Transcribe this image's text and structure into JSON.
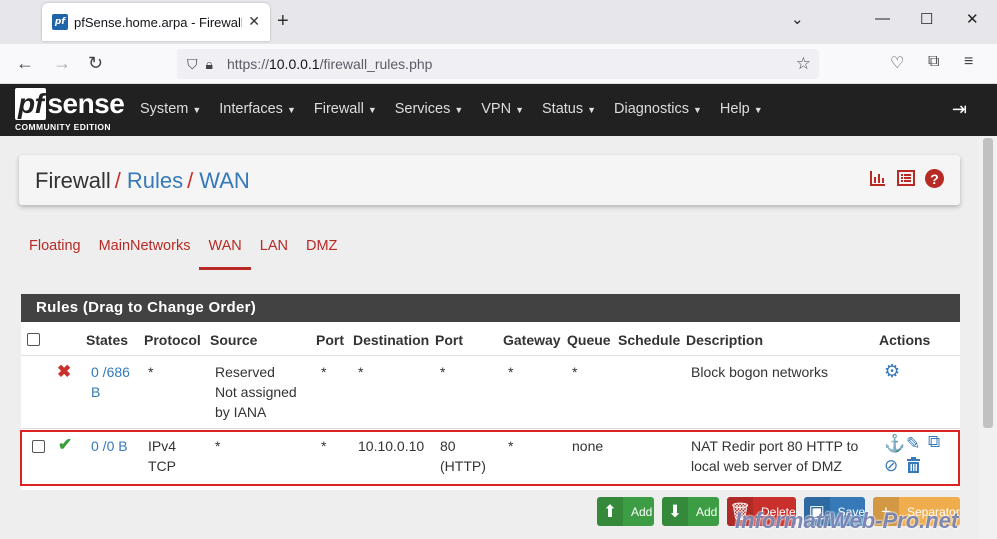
{
  "browser": {
    "tab_title": "pfSense.home.arpa - Firewall: R",
    "favicon_text": "pf",
    "url_prefix": "https://",
    "url_host": "10.0.0.1",
    "url_path": "/firewall_rules.php"
  },
  "header": {
    "logo_pf": "pf",
    "logo_sense": "sense",
    "logo_sub": "COMMUNITY EDITION",
    "menu": [
      "System",
      "Interfaces",
      "Firewall",
      "Services",
      "VPN",
      "Status",
      "Diagnostics",
      "Help"
    ]
  },
  "breadcrumb": {
    "home": "Firewall",
    "sep": "/",
    "rules": "Rules",
    "current": "WAN"
  },
  "tabs": [
    {
      "label": "Floating",
      "active": false
    },
    {
      "label": "MainNetworks",
      "active": false
    },
    {
      "label": "WAN",
      "active": true
    },
    {
      "label": "LAN",
      "active": false
    },
    {
      "label": "DMZ",
      "active": false
    }
  ],
  "rules_panel": {
    "title": "Rules (Drag to Change Order)",
    "columns": {
      "states": "States",
      "protocol": "Protocol",
      "source": "Source",
      "port": "Port",
      "destination": "Destination",
      "port2": "Port",
      "gateway": "Gateway",
      "queue": "Queue",
      "schedule": "Schedule",
      "description": "Description",
      "actions": "Actions"
    },
    "rows": [
      {
        "states_1": "0 /686",
        "states_2": "B",
        "protocol": "*",
        "source_1": "Reserved",
        "source_2": "Not assigned",
        "source_3": "by IANA",
        "port": "*",
        "destination": "*",
        "port2": "*",
        "gateway": "*",
        "queue": "*",
        "schedule": "",
        "description": "Block bogon networks"
      },
      {
        "states_1": "0 /0 B",
        "protocol_1": "IPv4",
        "protocol_2": "TCP",
        "source": "*",
        "port": "*",
        "destination": "10.10.0.10",
        "port2_1": "80",
        "port2_2": "(HTTP)",
        "gateway": "*",
        "queue": "none",
        "schedule": "",
        "description_1": "NAT Redir port 80 HTTP to",
        "description_2": "local web server of DMZ"
      }
    ]
  },
  "buttons": {
    "add_top": "Add",
    "add_bottom": "Add",
    "delete": "Delete",
    "save": "Save",
    "separator": "Separator"
  },
  "watermark": "InformatiWeb-Pro.net",
  "colors": {
    "accent_red": "#b82a25",
    "link_blue": "#3579b8",
    "header_dark": "#212121",
    "green": "#3c9d44",
    "orange": "#f0ad4e"
  }
}
